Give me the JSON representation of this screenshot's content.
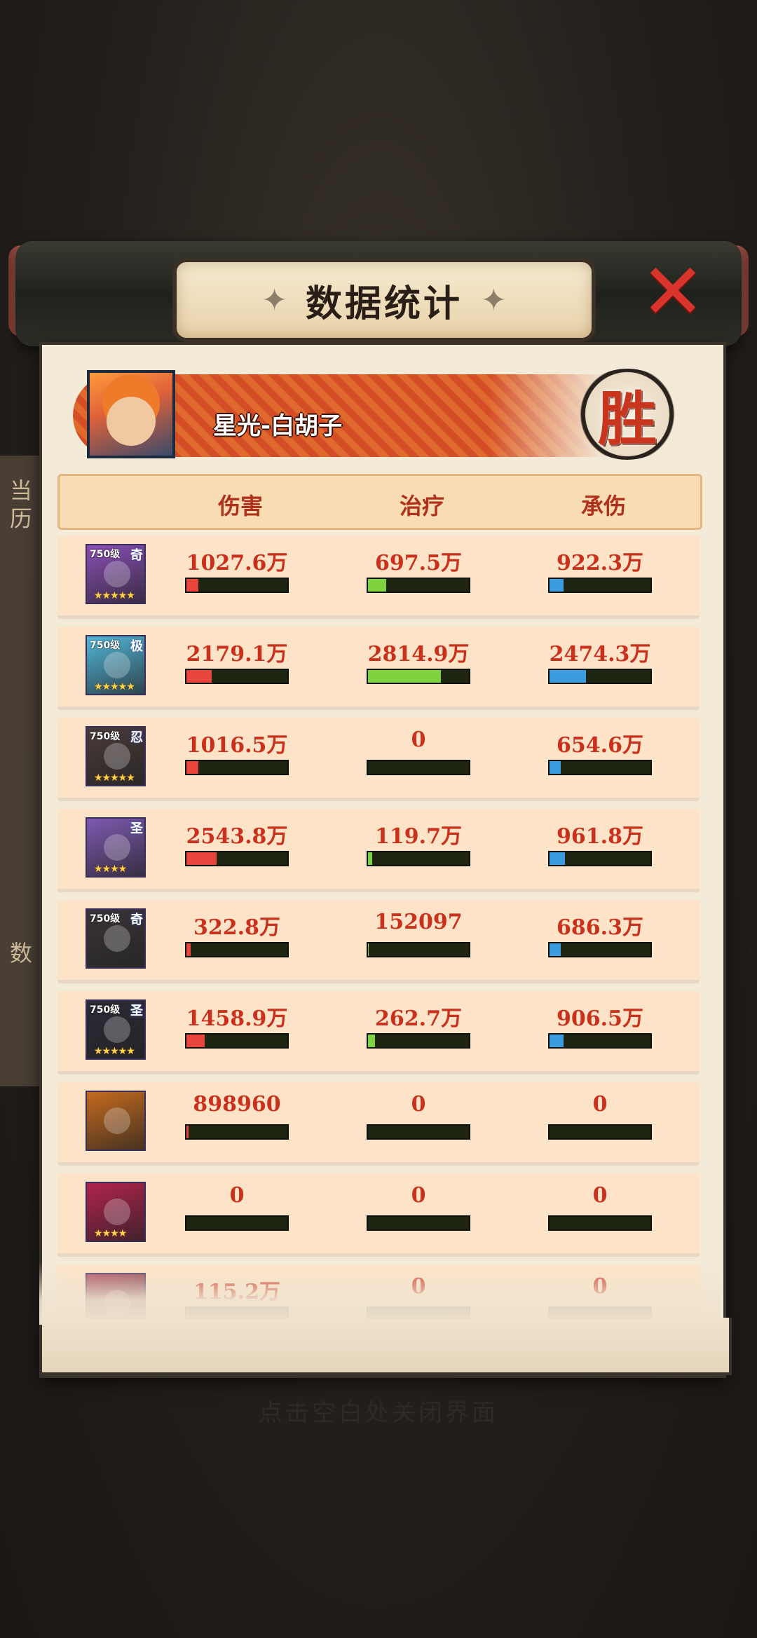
{
  "title": "数据统计",
  "close_icon": "close-x-icon",
  "player": {
    "name": "星光-白胡子",
    "result": "胜"
  },
  "columns": [
    "伤害",
    "治疗",
    "承伤"
  ],
  "hint": "点击空白处关闭界面",
  "background_side": {
    "top": "当历",
    "bottom": "数"
  },
  "colors": {
    "damage": "#e8453c",
    "heal": "#7ed33f",
    "taken": "#3d9be0",
    "value": "#c9311c"
  },
  "rows": [
    {
      "avatar": {
        "level": "750级",
        "tag": "奇",
        "bg": "#8a4fb5",
        "stars": "★★★★★"
      },
      "damage": "1027.6万",
      "heal": "697.5万",
      "taken": "922.3万",
      "bars": [
        0.12,
        0.18,
        0.14
      ]
    },
    {
      "avatar": {
        "level": "750级",
        "tag": "极",
        "bg": "#53b6d8",
        "stars": "★★★★★"
      },
      "damage": "2179.1万",
      "heal": "2814.9万",
      "taken": "2474.3万",
      "bars": [
        0.25,
        0.72,
        0.36
      ]
    },
    {
      "avatar": {
        "level": "750级",
        "tag": "忍",
        "bg": "#4a3a3a",
        "stars": "★★★★★"
      },
      "damage": "1016.5万",
      "heal": "0",
      "taken": "654.6万",
      "bars": [
        0.12,
        0,
        0.11
      ]
    },
    {
      "avatar": {
        "level": "",
        "tag": "圣",
        "bg": "#7e59b0",
        "stars": "★★★★"
      },
      "damage": "2543.8万",
      "heal": "119.7万",
      "taken": "961.8万",
      "bars": [
        0.3,
        0.04,
        0.15
      ]
    },
    {
      "avatar": {
        "level": "750级",
        "tag": "奇",
        "bg": "#3a3438",
        "stars": ""
      },
      "damage": "322.8万",
      "heal": "152097",
      "taken": "686.3万",
      "bars": [
        0.04,
        0.01,
        0.11
      ]
    },
    {
      "avatar": {
        "level": "750级",
        "tag": "圣",
        "bg": "#2c2a36",
        "stars": "★★★★★"
      },
      "damage": "1458.9万",
      "heal": "262.7万",
      "taken": "906.5万",
      "bars": [
        0.18,
        0.07,
        0.14
      ]
    },
    {
      "avatar": {
        "level": "",
        "tag": "",
        "bg": "#c46a1e",
        "stars": ""
      },
      "damage": "898960",
      "heal": "0",
      "taken": "0",
      "bars": [
        0.02,
        0,
        0
      ]
    },
    {
      "avatar": {
        "level": "",
        "tag": "",
        "bg": "#b0234e",
        "stars": "★★★★"
      },
      "damage": "0",
      "heal": "0",
      "taken": "0",
      "bars": [
        0,
        0,
        0
      ]
    },
    {
      "avatar": {
        "level": "",
        "tag": "",
        "bg": "#a83d55",
        "stars": ""
      },
      "damage": "115.2万",
      "heal": "0",
      "taken": "0",
      "bars": [
        0.02,
        0,
        0
      ]
    }
  ]
}
